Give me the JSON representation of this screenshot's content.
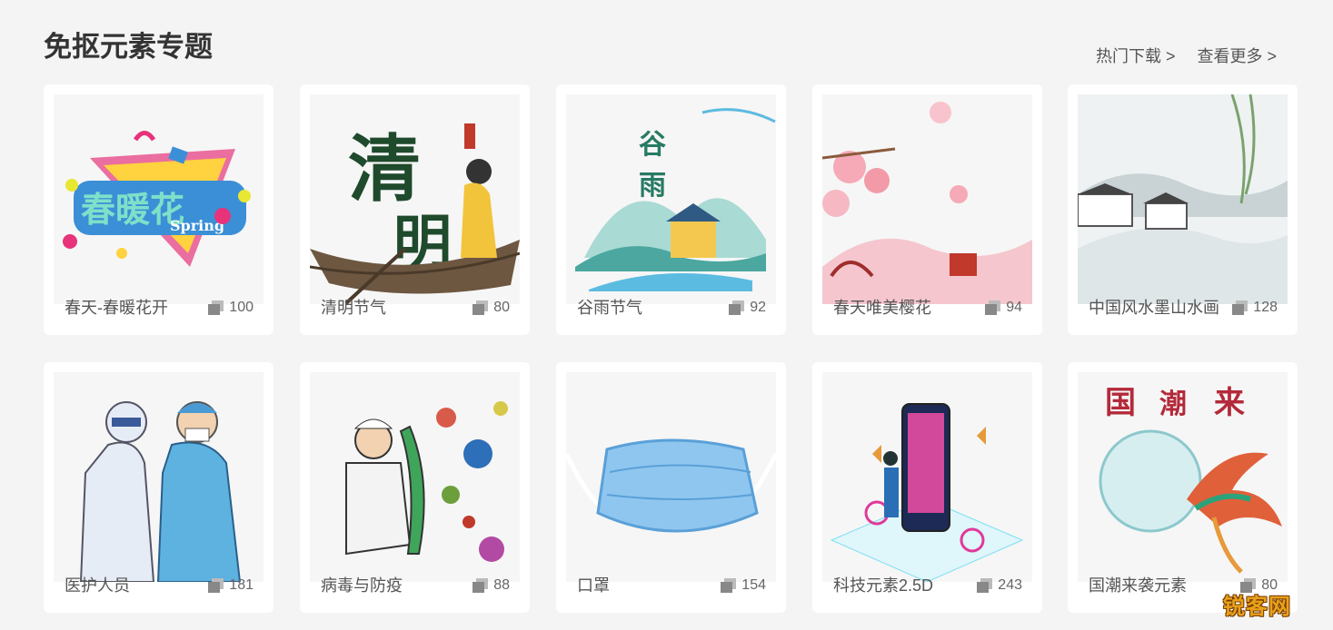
{
  "section": {
    "title": "免抠元素专题",
    "links": [
      "热门下载 >",
      "查看更多 >"
    ]
  },
  "cards": [
    {
      "caption": "春天-春暖花开",
      "count": "100",
      "image": "spring-flower-text-art"
    },
    {
      "caption": "清明节气",
      "count": "80",
      "image": "qingming-boat-girl"
    },
    {
      "caption": "谷雨节气",
      "count": "92",
      "image": "guyu-landscape"
    },
    {
      "caption": "春天唯美樱花",
      "count": "94",
      "image": "cherry-blossom-scene"
    },
    {
      "caption": "中国风水墨山水画",
      "count": "128",
      "image": "ink-landscape"
    },
    {
      "caption": "医护人员",
      "count": "181",
      "image": "medical-workers"
    },
    {
      "caption": "病毒与防疫",
      "count": "88",
      "image": "doctor-shield-virus"
    },
    {
      "caption": "口罩",
      "count": "154",
      "image": "face-mask"
    },
    {
      "caption": "科技元素2.5D",
      "count": "243",
      "image": "tech-isometric"
    },
    {
      "caption": "国潮来袭元素",
      "count": "80",
      "image": "guochao-phoenix"
    }
  ],
  "watermark": "锐客网",
  "colors": {
    "background": "#f4f4f4",
    "card": "#ffffff",
    "text": "#555555"
  }
}
